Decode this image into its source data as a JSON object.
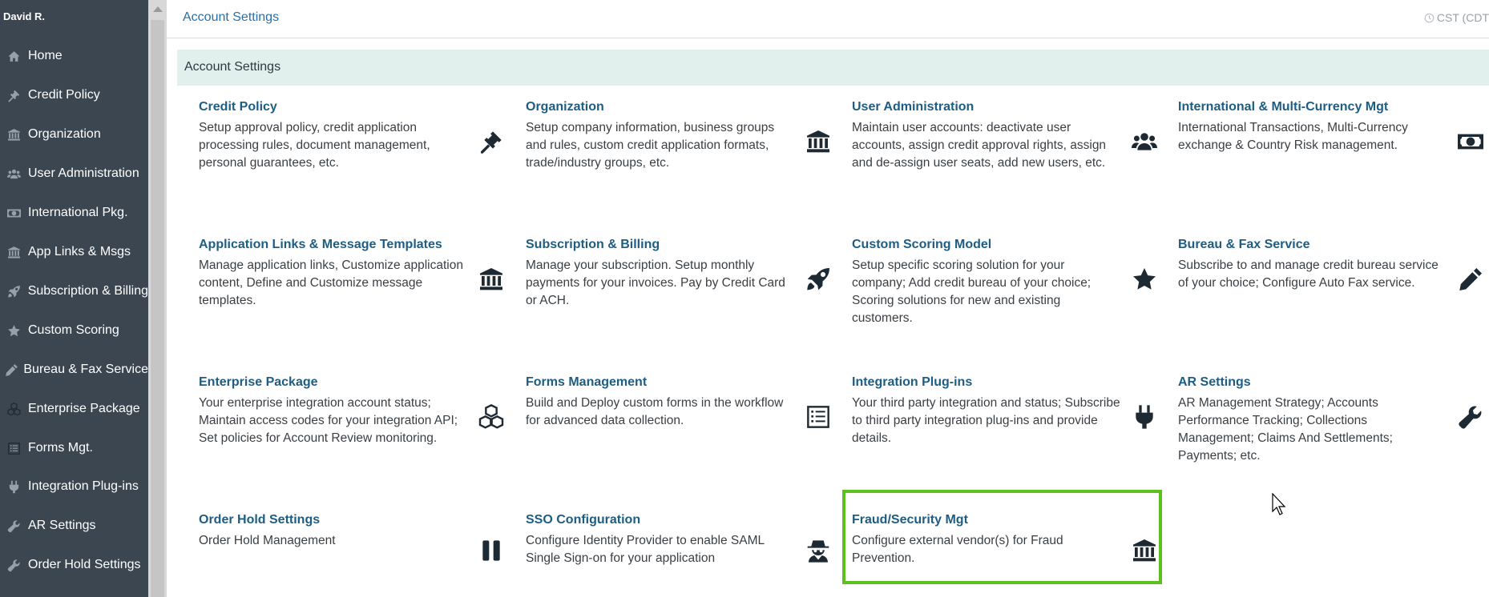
{
  "user": {
    "name": "David R."
  },
  "sidebar": {
    "items": [
      {
        "label": "Home",
        "icon": "home-icon"
      },
      {
        "label": "Credit Policy",
        "icon": "gavel-icon"
      },
      {
        "label": "Organization",
        "icon": "bank-icon"
      },
      {
        "label": "User Administration",
        "icon": "users-icon"
      },
      {
        "label": "International Pkg.",
        "icon": "money-icon"
      },
      {
        "label": "App Links & Msgs",
        "icon": "bank-icon"
      },
      {
        "label": "Subscription & Billing",
        "icon": "rocket-icon"
      },
      {
        "label": "Custom Scoring",
        "icon": "star-icon"
      },
      {
        "label": "Bureau & Fax Service",
        "icon": "pencil-icon"
      },
      {
        "label": "Enterprise Package",
        "icon": "cubes-icon"
      },
      {
        "label": "Forms Mgt.",
        "icon": "form-icon"
      },
      {
        "label": "Integration Plug-ins",
        "icon": "plug-icon"
      },
      {
        "label": "AR Settings",
        "icon": "wrench-icon"
      },
      {
        "label": "Order Hold Settings",
        "icon": "wrench-icon"
      }
    ]
  },
  "topbar": {
    "breadcrumb": "Account Settings",
    "timezone": "CST (CDT"
  },
  "section": {
    "title": "Account Settings"
  },
  "cards": [
    {
      "title": "Credit Policy",
      "desc": "Setup approval policy, credit application processing rules, document management, personal guarantees, etc.",
      "icon": "gavel-icon"
    },
    {
      "title": "Organization",
      "desc": "Setup company information, business groups and rules, custom credit application formats, trade/industry groups, etc.",
      "icon": "bank-icon"
    },
    {
      "title": "User Administration",
      "desc": "Maintain user accounts: deactivate user accounts, assign credit approval rights, assign and de-assign user seats, add new users, etc.",
      "icon": "users-icon"
    },
    {
      "title": "International & Multi-Currency Mgt",
      "desc": "International Transactions, Multi-Currency exchange & Country Risk management.",
      "icon": "money-icon"
    },
    {
      "title": "Application Links & Message Templates",
      "desc": "Manage application links, Customize application content, Define and Customize message templates.",
      "icon": "bank-icon"
    },
    {
      "title": "Subscription & Billing",
      "desc": "Manage your subscription. Setup monthly payments for your invoices. Pay by Credit Card or ACH.",
      "icon": "rocket-icon"
    },
    {
      "title": "Custom Scoring Model",
      "desc": "Setup specific scoring solution for your company; Add credit bureau of your choice; Scoring solutions for new and existing customers.",
      "icon": "star-icon"
    },
    {
      "title": "Bureau & Fax Service",
      "desc": "Subscribe to and manage credit bureau service of your choice; Configure Auto Fax service.",
      "icon": "pencil-icon"
    },
    {
      "title": "Enterprise Package",
      "desc": "Your enterprise integration account status; Maintain access codes for your integration API; Set policies for Account Review monitoring.",
      "icon": "cubes-icon"
    },
    {
      "title": "Forms Management",
      "desc": "Build and Deploy custom forms in the workflow for advanced data collection.",
      "icon": "form-icon"
    },
    {
      "title": "Integration Plug-ins",
      "desc": "Your third party integration and status; Subscribe to third party integration plug-ins and provide details.",
      "icon": "plug-icon"
    },
    {
      "title": "AR Settings",
      "desc": "AR Management Strategy; Accounts Performance Tracking; Collections Management; Claims And Settlements; Payments; etc.",
      "icon": "wrench-icon"
    },
    {
      "title": "Order Hold Settings",
      "desc": "Order Hold Management",
      "icon": "pause-icon"
    },
    {
      "title": "SSO Configuration",
      "desc": "Configure Identity Provider to enable SAML Single Sign-on for your application",
      "icon": "spy-icon"
    },
    {
      "title": "Fraud/Security Mgt",
      "desc": "Configure external vendor(s) for Fraud Prevention.",
      "icon": "bank-icon"
    }
  ]
}
